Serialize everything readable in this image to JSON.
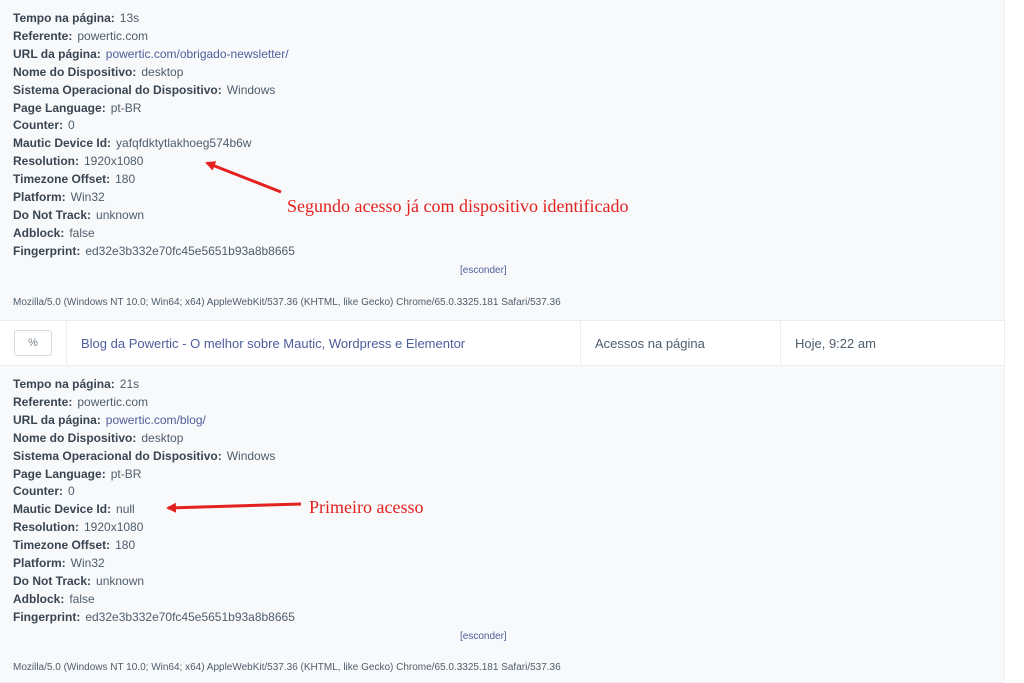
{
  "first_visit": {
    "fields": [
      {
        "label": "Tempo na página:",
        "value": "13s",
        "link": false
      },
      {
        "label": "Referente:",
        "value": "powertic.com",
        "link": false
      },
      {
        "label": "URL da página:",
        "value": "powertic.com/obrigado-newsletter/",
        "link": true
      },
      {
        "label": "Nome do Dispositivo:",
        "value": "desktop",
        "link": false
      },
      {
        "label": "Sistema Operacional do Dispositivo:",
        "value": "Windows",
        "link": false
      },
      {
        "label": "Page Language:",
        "value": "pt-BR",
        "link": false
      },
      {
        "label": "Counter:",
        "value": "0",
        "link": false
      },
      {
        "label": "Mautic Device Id:",
        "value": "yafqfdktytlakhoeg574b6w",
        "link": false
      },
      {
        "label": "Resolution:",
        "value": "1920x1080",
        "link": false
      },
      {
        "label": "Timezone Offset:",
        "value": "180",
        "link": false
      },
      {
        "label": "Platform:",
        "value": "Win32",
        "link": false
      },
      {
        "label": "Do Not Track:",
        "value": "unknown",
        "link": false
      },
      {
        "label": "Adblock:",
        "value": "false",
        "link": false
      },
      {
        "label": "Fingerprint:",
        "value": "ed32e3b332e70fc45e5651b93a8b8665",
        "link": false
      }
    ],
    "hide_label": "[esconder]",
    "user_agent": "Mozilla/5.0 (Windows NT 10.0; Win64; x64) AppleWebKit/537.36 (KHTML, like Gecko) Chrome/65.0.3325.181 Safari/537.36",
    "annotation": "Segundo acesso já com dispositivo identificado"
  },
  "event_row": {
    "link_icon": "link-icon",
    "link_glyph": "%",
    "title": "Blog da Powertic - O melhor sobre Mautic, Wordpress e Elementor",
    "type": "Acessos na página",
    "date": "Hoje, 9:22 am"
  },
  "second_visit": {
    "fields": [
      {
        "label": "Tempo na página:",
        "value": "21s",
        "link": false
      },
      {
        "label": "Referente:",
        "value": "powertic.com",
        "link": false
      },
      {
        "label": "URL da página:",
        "value": "powertic.com/blog/",
        "link": true
      },
      {
        "label": "Nome do Dispositivo:",
        "value": "desktop",
        "link": false
      },
      {
        "label": "Sistema Operacional do Dispositivo:",
        "value": "Windows",
        "link": false
      },
      {
        "label": "Page Language:",
        "value": "pt-BR",
        "link": false
      },
      {
        "label": "Counter:",
        "value": "0",
        "link": false
      },
      {
        "label": "Mautic Device Id:",
        "value": "null",
        "link": false
      },
      {
        "label": "Resolution:",
        "value": "1920x1080",
        "link": false
      },
      {
        "label": "Timezone Offset:",
        "value": "180",
        "link": false
      },
      {
        "label": "Platform:",
        "value": "Win32",
        "link": false
      },
      {
        "label": "Do Not Track:",
        "value": "unknown",
        "link": false
      },
      {
        "label": "Adblock:",
        "value": "false",
        "link": false
      },
      {
        "label": "Fingerprint:",
        "value": "ed32e3b332e70fc45e5651b93a8b8665",
        "link": false
      }
    ],
    "hide_label": "[esconder]",
    "user_agent": "Mozilla/5.0 (Windows NT 10.0; Win64; x64) AppleWebKit/537.36 (KHTML, like Gecko) Chrome/65.0.3325.181 Safari/537.36",
    "annotation": "Primeiro acesso"
  },
  "colors": {
    "annotation": "#e3211f",
    "link": "#4e5d9c",
    "panel": "#f8f9fa"
  }
}
